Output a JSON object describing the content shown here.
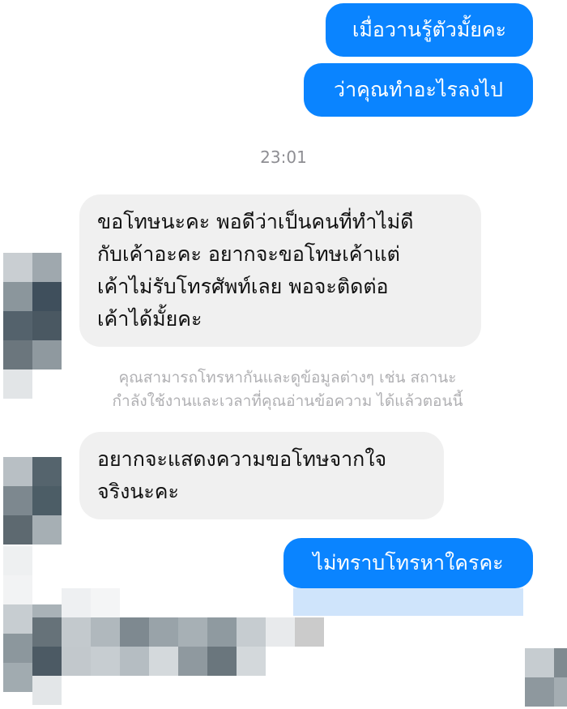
{
  "messages": {
    "sent_1": "เมื่อวานรู้ตัวมั้ยคะ",
    "sent_2": "ว่าคุณทำอะไรลงไป",
    "timestamp": "23:01",
    "recv_1": "ขอโทษนะคะ พอดีว่าเป็นคนที่ทำไม่ดี\nกับเค้าอะคะ อยากจะขอโทษเค้าแต่\nเค้าไม่รับโทรศัพท์เลย พอจะติดต่อ\nเค้าได้มั้ยคะ",
    "notice": "คุณสามารถโทรหากันและดูข้อมูลต่างๆ เช่น สถานะ\nกำลังใช้งานและเวลาที่คุณอ่านข้อความ ได้แล้วตอนนี้",
    "recv_2": "อยากจะแสดงความขอโทษจากใจ\nจริงนะคะ",
    "sent_3": "ไม่ทราบโทรหาใครคะ"
  },
  "colors": {
    "sent_bubble": "#0a84ff",
    "received_bubble": "#f0f0f0",
    "timestamp_text": "#8e8e93",
    "notice_text": "#b0b0b3"
  },
  "redaction": "pixelated mosaic"
}
